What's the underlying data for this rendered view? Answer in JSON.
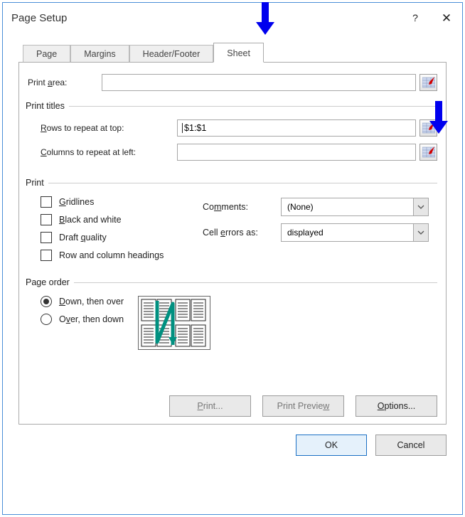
{
  "title": "Page Setup",
  "tabs": [
    "Page",
    "Margins",
    "Header/Footer",
    "Sheet"
  ],
  "activeTabIndex": 3,
  "printArea": {
    "label": "Print area:",
    "accel": "a",
    "value": ""
  },
  "printTitles": {
    "legend": "Print titles",
    "rows": {
      "label": "Rows to repeat at top:",
      "accel": "R",
      "value": "$1:$1"
    },
    "cols": {
      "label": "Columns to repeat at left:",
      "accel": "C",
      "value": ""
    }
  },
  "print": {
    "legend": "Print",
    "gridlines": {
      "label": "Gridlines",
      "accel": "G",
      "checked": false
    },
    "bw": {
      "label": "Black and white",
      "accel": "B",
      "checked": false
    },
    "draft": {
      "label": "Draft quality",
      "accel": "q",
      "checked": false
    },
    "headings": {
      "label": "Row and column headings",
      "checked": false
    },
    "comments": {
      "label": "Comments:",
      "accel": "m",
      "value": "(None)"
    },
    "cellErrors": {
      "label": "Cell errors as:",
      "accel": "e",
      "value": "displayed"
    }
  },
  "pageOrder": {
    "legend": "Page order",
    "down": {
      "label": "Down, then over",
      "accel": "D",
      "selected": true
    },
    "over": {
      "label": "Over, then down",
      "accel": "v",
      "selected": false
    }
  },
  "buttons": {
    "print": "Print...",
    "preview": "Print Preview",
    "options": "Options...",
    "ok": "OK",
    "cancel": "Cancel"
  }
}
